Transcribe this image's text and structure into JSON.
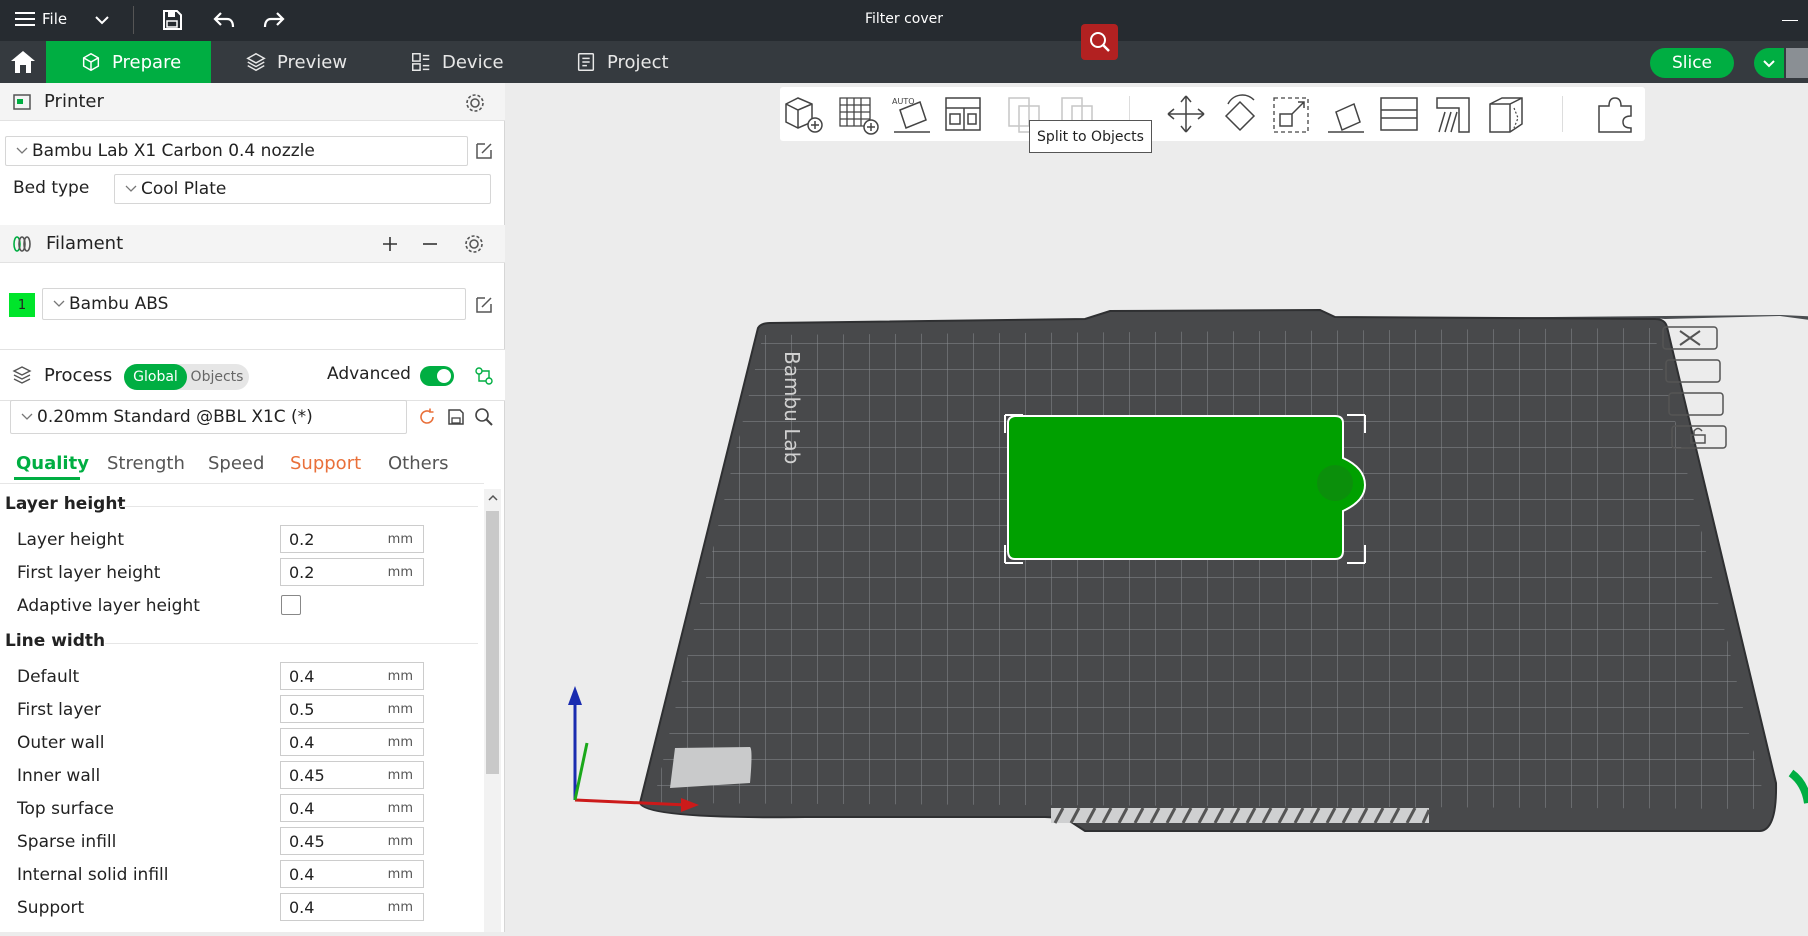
{
  "window": {
    "menu_label": "File",
    "title": "Filter cover"
  },
  "tabs": [
    {
      "label": "Prepare",
      "icon": "cube-icon",
      "active": true
    },
    {
      "label": "Preview",
      "icon": "layers-icon",
      "active": false
    },
    {
      "label": "Device",
      "icon": "device-icon",
      "active": false
    },
    {
      "label": "Project",
      "icon": "project-icon",
      "active": false
    }
  ],
  "actions": {
    "slice_label": "Slice"
  },
  "printer": {
    "section_label": "Printer",
    "preset": "Bambu Lab X1 Carbon 0.4 nozzle",
    "bed_type_label": "Bed type",
    "bed_type": "Cool Plate"
  },
  "filament": {
    "section_label": "Filament",
    "slots": [
      {
        "index": "1",
        "name": "Bambu ABS",
        "color": "#00e52b"
      }
    ]
  },
  "process": {
    "section_label": "Process",
    "scope_options": [
      "Global",
      "Objects"
    ],
    "scope_selected": "Global",
    "advanced_label": "Advanced",
    "advanced_on": true,
    "preset": "0.20mm Standard @BBL X1C (*)",
    "tabs": [
      "Quality",
      "Strength",
      "Speed",
      "Support",
      "Others"
    ],
    "active_tab": "Quality",
    "groups": [
      {
        "title": "Layer height",
        "params": [
          {
            "label": "Layer height",
            "value": "0.2",
            "unit": "mm"
          },
          {
            "label": "First layer height",
            "value": "0.2",
            "unit": "mm"
          },
          {
            "label": "Adaptive layer height",
            "checkbox": true,
            "checked": false
          }
        ]
      },
      {
        "title": "Line width",
        "params": [
          {
            "label": "Default",
            "value": "0.4",
            "unit": "mm"
          },
          {
            "label": "First layer",
            "value": "0.5",
            "unit": "mm"
          },
          {
            "label": "Outer wall",
            "value": "0.4",
            "unit": "mm"
          },
          {
            "label": "Inner wall",
            "value": "0.45",
            "unit": "mm"
          },
          {
            "label": "Top surface",
            "value": "0.4",
            "unit": "mm"
          },
          {
            "label": "Sparse infill",
            "value": "0.45",
            "unit": "mm"
          },
          {
            "label": "Internal solid infill",
            "value": "0.4",
            "unit": "mm"
          },
          {
            "label": "Support",
            "value": "0.4",
            "unit": "mm"
          }
        ]
      }
    ]
  },
  "canvas": {
    "tooltip": "Split to Objects",
    "plate_brand": "Bambu Lab",
    "model_color": "#00a000",
    "accent_color": "#00ae42"
  }
}
